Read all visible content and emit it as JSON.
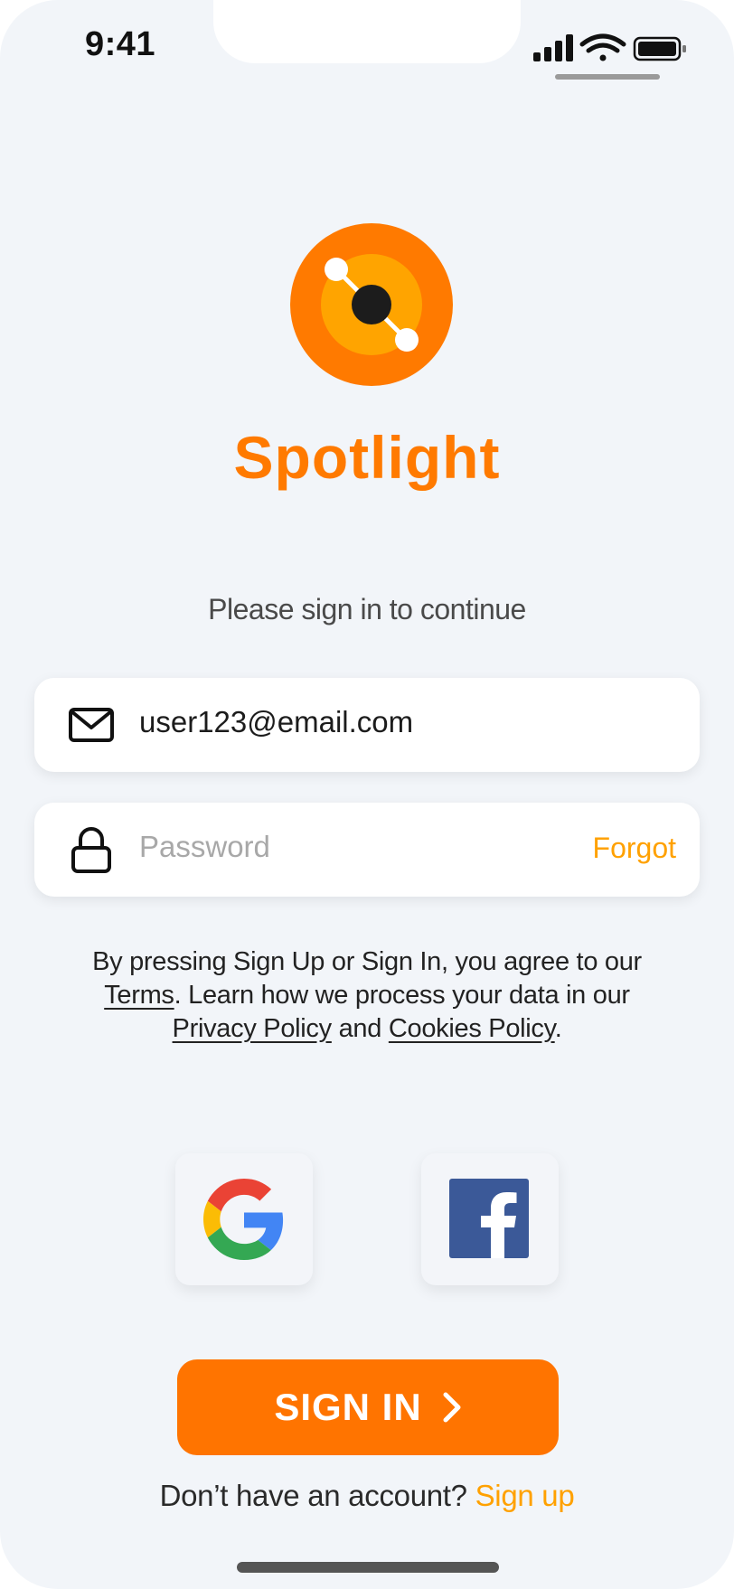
{
  "status_bar": {
    "time": "9:41",
    "icons": [
      "cellular-signal-icon",
      "wifi-icon",
      "battery-icon"
    ]
  },
  "app": {
    "name": "Spotlight",
    "logo_icon": "spotlight-logo-icon"
  },
  "prompt": "Please sign in to continue",
  "email_field": {
    "icon": "mail-icon",
    "value": "user123@email.com"
  },
  "password_field": {
    "icon": "lock-icon",
    "placeholder": "Password",
    "forgot_label": "Forgot"
  },
  "legal": {
    "part1": "By pressing Sign Up or Sign In, you agree to our ",
    "terms": "Terms",
    "part2": ". Learn how we process your data in our ",
    "privacy": "Privacy Policy",
    "and": " and ",
    "cookies": "Cookies Policy",
    "end": "."
  },
  "social": [
    {
      "name": "google",
      "icon": "google-icon"
    },
    {
      "name": "facebook",
      "icon": "facebook-icon"
    }
  ],
  "sign_in_button": {
    "label": "SIGN IN",
    "icon": "chevron-right-icon"
  },
  "signup": {
    "question": "Don’t have an account? ",
    "link": "Sign up"
  },
  "colors": {
    "primary_orange": "#FF7400",
    "accent_yellow": "#FFA100",
    "background": "#F2F5F9"
  }
}
